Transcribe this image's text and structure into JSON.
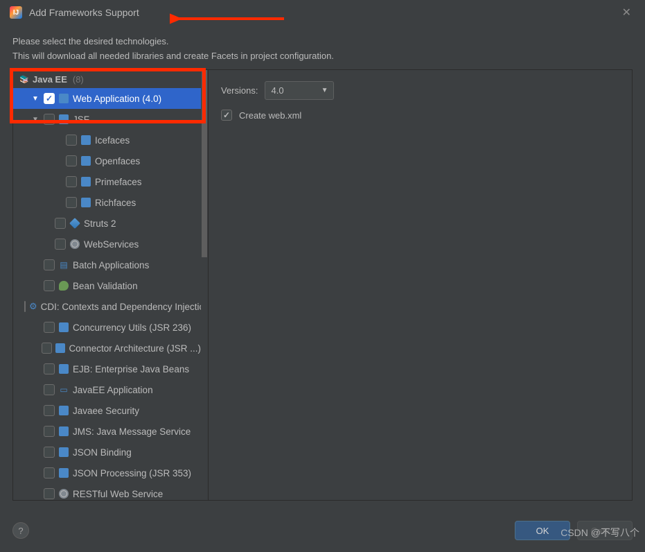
{
  "window": {
    "title": "Add Frameworks Support",
    "description_line1": "Please select the desired technologies.",
    "description_line2": "This will download all needed libraries and create Facets in project configuration."
  },
  "tree": {
    "group": {
      "label": "Java EE",
      "count": "(8)"
    },
    "items": [
      {
        "id": "web-app",
        "label": "Web Application (4.0)",
        "indent": 1,
        "checked": true,
        "selected": true,
        "arrow": "down",
        "icon": "web"
      },
      {
        "id": "jsf",
        "label": "JSF",
        "indent": 2,
        "checked": false,
        "selected": false,
        "arrow": "down",
        "icon": "comp"
      },
      {
        "id": "icefaces",
        "label": "Icefaces",
        "indent": 4,
        "checked": false,
        "icon": "comp"
      },
      {
        "id": "openfaces",
        "label": "Openfaces",
        "indent": 4,
        "checked": false,
        "icon": "comp"
      },
      {
        "id": "primefaces",
        "label": "Primefaces",
        "indent": 4,
        "checked": false,
        "icon": "comp"
      },
      {
        "id": "richfaces",
        "label": "Richfaces",
        "indent": 4,
        "checked": false,
        "icon": "comp"
      },
      {
        "id": "struts2",
        "label": "Struts 2",
        "indent": 3,
        "checked": false,
        "icon": "struts"
      },
      {
        "id": "webservices",
        "label": "WebServices",
        "indent": 3,
        "checked": false,
        "icon": "ws"
      },
      {
        "id": "batch",
        "label": "Batch Applications",
        "indent": 2,
        "checked": false,
        "icon": "batch"
      },
      {
        "id": "beanval",
        "label": "Bean Validation",
        "indent": 2,
        "checked": false,
        "icon": "bean"
      },
      {
        "id": "cdi",
        "label": "CDI: Contexts and Dependency Injection",
        "indent": 2,
        "checked": false,
        "icon": "cdi"
      },
      {
        "id": "concurrency",
        "label": "Concurrency Utils (JSR 236)",
        "indent": 2,
        "checked": false,
        "icon": "folder"
      },
      {
        "id": "connector",
        "label": "Connector Architecture (JSR ...)",
        "indent": 2,
        "checked": false,
        "icon": "folder"
      },
      {
        "id": "ejb",
        "label": "EJB: Enterprise Java Beans",
        "indent": 2,
        "checked": false,
        "icon": "folder"
      },
      {
        "id": "javaeeapp",
        "label": "JavaEE Application",
        "indent": 2,
        "checked": false,
        "icon": "jee"
      },
      {
        "id": "javaee-sec",
        "label": "Javaee Security",
        "indent": 2,
        "checked": false,
        "icon": "folder"
      },
      {
        "id": "jms",
        "label": "JMS: Java Message Service",
        "indent": 2,
        "checked": false,
        "icon": "folder"
      },
      {
        "id": "json-bind",
        "label": "JSON Binding",
        "indent": 2,
        "checked": false,
        "icon": "folder"
      },
      {
        "id": "json-proc",
        "label": "JSON Processing (JSR 353)",
        "indent": 2,
        "checked": false,
        "icon": "folder"
      },
      {
        "id": "restful",
        "label": "RESTful Web Service",
        "indent": 2,
        "checked": false,
        "icon": "ws"
      }
    ]
  },
  "right": {
    "versions_label": "Versions:",
    "version_value": "4.0",
    "create_webxml_label": "Create web.xml",
    "create_webxml_checked": true
  },
  "footer": {
    "ok": "OK",
    "cancel": "Cancel",
    "help": "?"
  },
  "watermark": "CSDN @不写八个"
}
